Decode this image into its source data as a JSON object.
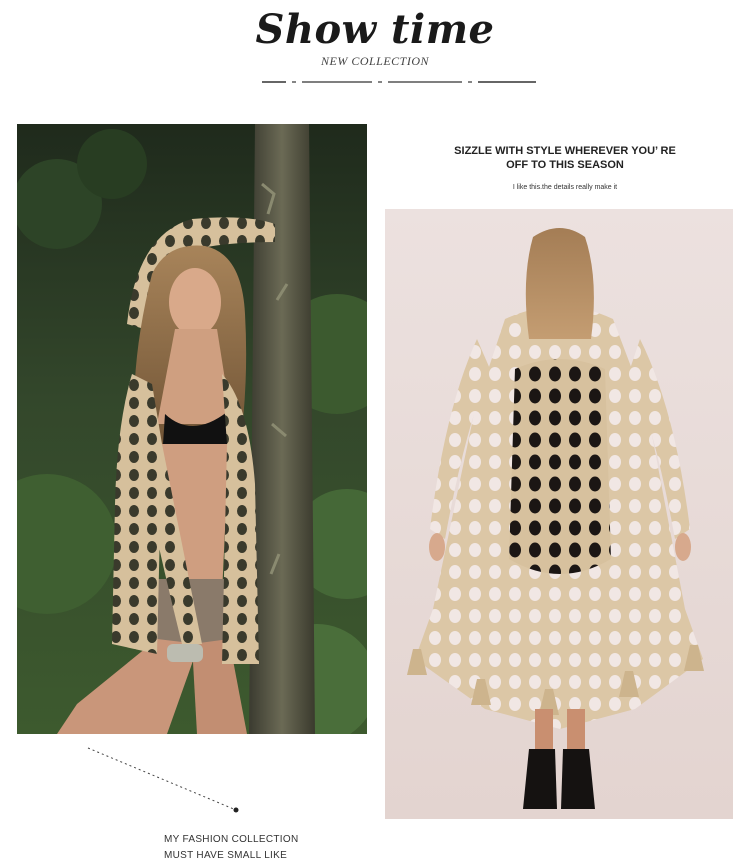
{
  "header": {
    "title": "Show time",
    "subtitle": "NEW COLLECTION"
  },
  "promo": {
    "headline_line1": "SIZZLE WITH STYLE WHEREVER YOU’ RE",
    "headline_line2": "OFF TO THIS SEASON",
    "tagline": "I like this.the details really make it"
  },
  "caption": {
    "line1": "MY FASHION COLLECTION",
    "line2": "MUST HAVE SMALL LIKE"
  },
  "images": {
    "left": "model-forest-crochet-cardigan-photo",
    "right": "model-back-view-crochet-cardigan-photo"
  },
  "colors": {
    "crochet": "#d8c3a2",
    "forest": "#2a3a25",
    "studio_bg": "#e8dcd8"
  }
}
